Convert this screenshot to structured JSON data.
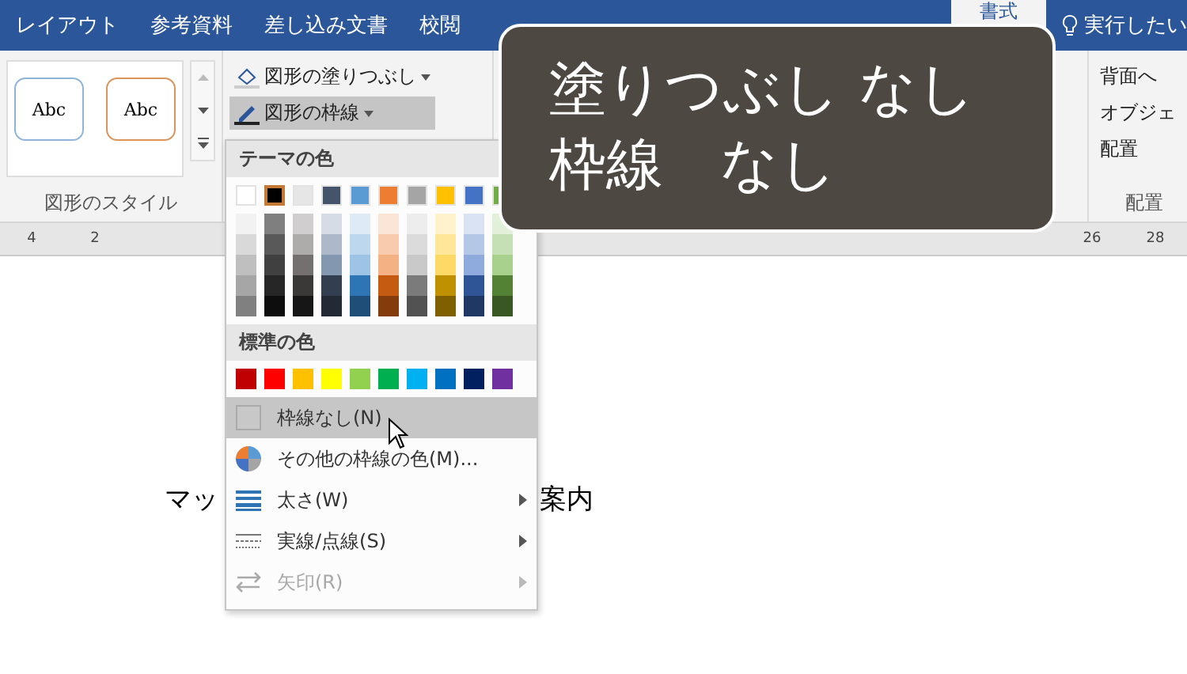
{
  "tabs": [
    {
      "label": "レイアウト",
      "selected": false
    },
    {
      "label": "参考資料",
      "selected": false
    },
    {
      "label": "差し込み文書",
      "selected": false
    },
    {
      "label": "校閲",
      "selected": false
    },
    {
      "label": "書式",
      "selected": true
    }
  ],
  "tell_me": "実行したい",
  "ribbon": {
    "style_gallery": [
      "Abc",
      "Abc"
    ],
    "style_group_label": "図形のスタイル",
    "shape_buttons": [
      {
        "label": "図形の塗りつぶし",
        "pressed": false
      },
      {
        "label": "図形の枠線",
        "pressed": true
      }
    ],
    "arrange_buttons": [
      "背面へ",
      "オブジェ",
      "配置"
    ],
    "arrange_group_label": "配置"
  },
  "ruler": {
    "left_numbers": [
      "4",
      "2"
    ],
    "right_numbers": [
      "26",
      "28"
    ]
  },
  "document": {
    "text_before": "マッ",
    "text_after": "案内"
  },
  "menu": {
    "theme_header": "テーマの色",
    "theme_colors": [
      {
        "color": "#ffffff",
        "selected": false,
        "shades": [
          {
            "color": "#f2f2f2"
          },
          {
            "color": "#d9d9d9"
          },
          {
            "color": "#bfbfbf"
          },
          {
            "color": "#a6a6a6"
          },
          {
            "color": "#808080"
          }
        ]
      },
      {
        "color": "#000000",
        "selected": true,
        "shades": [
          {
            "color": "#7f7f7f"
          },
          {
            "color": "#595959"
          },
          {
            "color": "#404040"
          },
          {
            "color": "#262626"
          },
          {
            "color": "#0d0d0d"
          }
        ]
      },
      {
        "color": "#e7e6e6",
        "selected": false,
        "shades": [
          {
            "color": "#d0cece"
          },
          {
            "color": "#aeabab"
          },
          {
            "color": "#757070"
          },
          {
            "color": "#3b3838"
          },
          {
            "color": "#171616"
          }
        ]
      },
      {
        "color": "#44546a",
        "selected": false,
        "shades": [
          {
            "color": "#d6dce5"
          },
          {
            "color": "#adb9ca"
          },
          {
            "color": "#8497b0"
          },
          {
            "color": "#333f50"
          },
          {
            "color": "#222a35"
          }
        ]
      },
      {
        "color": "#5b9bd5",
        "selected": false,
        "shades": [
          {
            "color": "#deebf7"
          },
          {
            "color": "#bdd7ee"
          },
          {
            "color": "#9dc3e6"
          },
          {
            "color": "#2e75b6"
          },
          {
            "color": "#1f4e79"
          }
        ]
      },
      {
        "color": "#ed7d31",
        "selected": false,
        "shades": [
          {
            "color": "#fbe5d6"
          },
          {
            "color": "#f8cbad"
          },
          {
            "color": "#f4b183"
          },
          {
            "color": "#c55a11"
          },
          {
            "color": "#843c0c"
          }
        ]
      },
      {
        "color": "#a5a5a5",
        "selected": false,
        "shades": [
          {
            "color": "#ededed"
          },
          {
            "color": "#dbdbdb"
          },
          {
            "color": "#c9c9c9"
          },
          {
            "color": "#7b7b7b"
          },
          {
            "color": "#525252"
          }
        ]
      },
      {
        "color": "#ffc000",
        "selected": false,
        "shades": [
          {
            "color": "#fff2cc"
          },
          {
            "color": "#ffe699"
          },
          {
            "color": "#ffd966"
          },
          {
            "color": "#bf9000"
          },
          {
            "color": "#7f6000"
          }
        ]
      },
      {
        "color": "#4472c4",
        "selected": false,
        "shades": [
          {
            "color": "#dae3f3"
          },
          {
            "color": "#b4c7e7"
          },
          {
            "color": "#8faadc"
          },
          {
            "color": "#2f5597"
          },
          {
            "color": "#203864"
          }
        ]
      },
      {
        "color": "#70ad47",
        "selected": false,
        "shades": [
          {
            "color": "#e2f0d9"
          },
          {
            "color": "#c5e0b4"
          },
          {
            "color": "#a9d18e"
          },
          {
            "color": "#548235"
          },
          {
            "color": "#385723"
          }
        ]
      }
    ],
    "standard_header": "標準の色",
    "standard_colors": [
      {
        "color": "#c00000"
      },
      {
        "color": "#ff0000"
      },
      {
        "color": "#ffc000"
      },
      {
        "color": "#ffff00"
      },
      {
        "color": "#92d050"
      },
      {
        "color": "#00b050"
      },
      {
        "color": "#00b0f0"
      },
      {
        "color": "#0070c0"
      },
      {
        "color": "#002060"
      },
      {
        "color": "#7030a0"
      }
    ],
    "items": [
      {
        "kind": "none",
        "label": "枠線なし(N)",
        "highlighted": true,
        "disabled": false,
        "submenu": false
      },
      {
        "kind": "more",
        "label": "その他の枠線の色(M)...",
        "highlighted": false,
        "disabled": false,
        "submenu": false
      },
      {
        "kind": "weight",
        "label": "太さ(W)",
        "highlighted": false,
        "disabled": false,
        "submenu": true
      },
      {
        "kind": "dash",
        "label": "実線/点線(S)",
        "highlighted": false,
        "disabled": false,
        "submenu": true
      },
      {
        "kind": "arrow",
        "label": "矢印(R)",
        "highlighted": false,
        "disabled": true,
        "submenu": true
      }
    ]
  },
  "caption": [
    "塗りつぶし なし",
    "枠線　なし"
  ]
}
